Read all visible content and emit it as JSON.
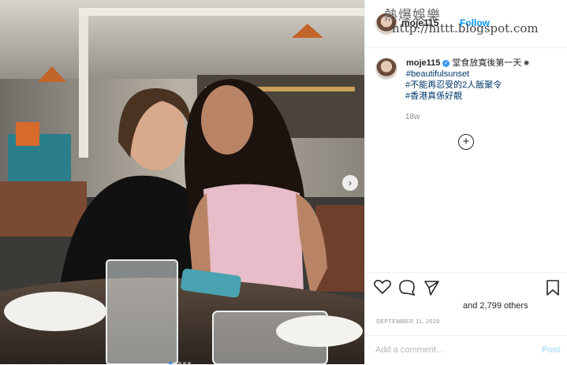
{
  "header": {
    "username": "moje115",
    "follow_label": "Follow"
  },
  "watermark": {
    "title": "熱爆娛樂",
    "url": "http://hittt.blogspot.com"
  },
  "caption": {
    "username": "moje115",
    "text": "堂食放寬後第一天",
    "hashtags": [
      "#beautifulsunset",
      "#不能再忍受的2人飯聚令",
      "#香港真係好靚"
    ],
    "age": "18w"
  },
  "actions": {
    "icons": [
      "heart-icon",
      "comment-icon",
      "share-icon",
      "bookmark-icon"
    ],
    "likes_text": "and 2,799 others"
  },
  "post_date": "SEPTEMBER 11, 2020",
  "comment": {
    "placeholder": "Add a comment...",
    "post_label": "Post"
  },
  "colors": {
    "link": "#0095f6",
    "hashtag": "#00376b",
    "verified": "#3897f0"
  }
}
